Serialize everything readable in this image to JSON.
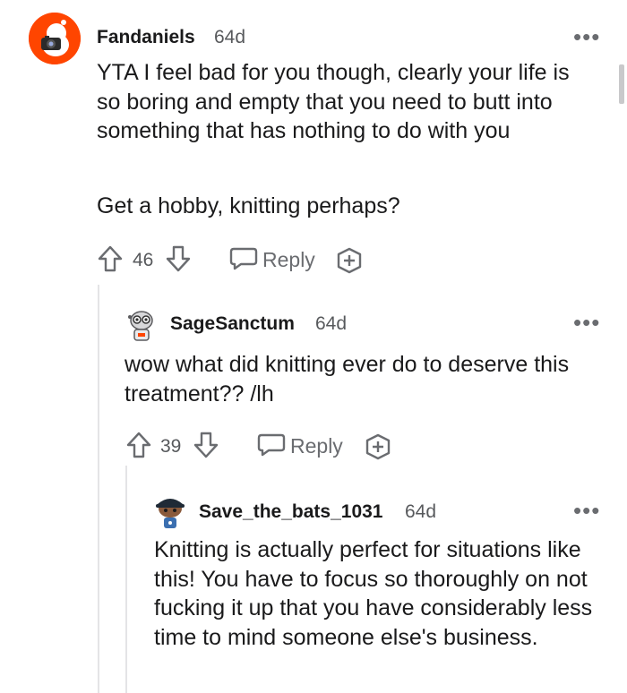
{
  "comments": [
    {
      "username": "Fandaniels",
      "age": "64d",
      "paragraphs": [
        "YTA I feel bad for you though, clearly your life is so boring and empty that you need to butt into something that has nothing to do with you",
        "Get a hobby, knitting perhaps?"
      ],
      "votes": "46",
      "reply_label": "Reply"
    },
    {
      "username": "SageSanctum",
      "age": "64d",
      "paragraphs": [
        "wow what did knitting ever do to deserve this treatment?? /lh"
      ],
      "votes": "39",
      "reply_label": "Reply"
    },
    {
      "username": "Save_the_bats_1031",
      "age": "64d",
      "paragraphs": [
        "Knitting is actually perfect for situations like this! You have to focus so thoroughly on not fucking it up that you have considerably less time to mind someone else's business."
      ]
    }
  ],
  "more_label": "•••",
  "colors": {
    "avatar_orange": "#ff4500",
    "text": "#1a1a1b",
    "meta": "#57595c"
  }
}
